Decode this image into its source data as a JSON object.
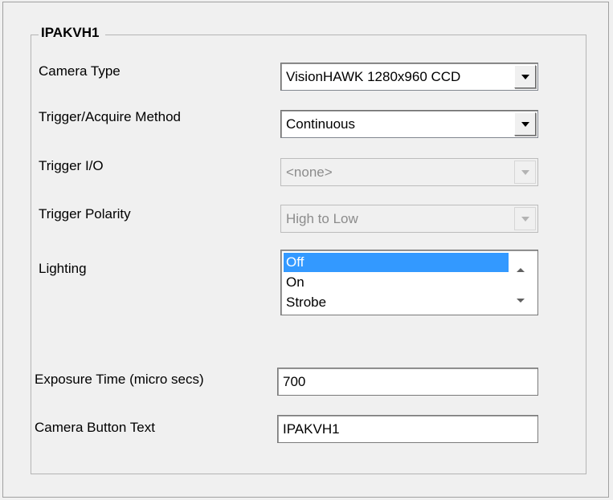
{
  "group": {
    "title": "IPAKVH1"
  },
  "fields": {
    "camera_type": {
      "label": "Camera Type",
      "value": "VisionHAWK 1280x960 CCD"
    },
    "trigger_method": {
      "label": "Trigger/Acquire Method",
      "value": "Continuous"
    },
    "trigger_io": {
      "label": "Trigger I/O",
      "value": "<none>",
      "disabled": true
    },
    "trigger_polarity": {
      "label": "Trigger Polarity",
      "value": "High to Low",
      "disabled": true
    },
    "lighting": {
      "label": "Lighting",
      "options": [
        "Off",
        "On",
        "Strobe"
      ],
      "selected": "Off"
    },
    "exposure_time": {
      "label": "Exposure Time (micro secs)",
      "value": "700"
    },
    "camera_button_text": {
      "label": "Camera Button Text",
      "value": "IPAKVH1"
    }
  },
  "icons": {
    "dropdown": "chevron-down-icon",
    "scroll_up": "scroll-up-icon",
    "scroll_down": "scroll-down-icon"
  },
  "colors": {
    "selection": "#3399ff",
    "background": "#f0f0f0",
    "disabled_text": "#8c8c8c"
  }
}
